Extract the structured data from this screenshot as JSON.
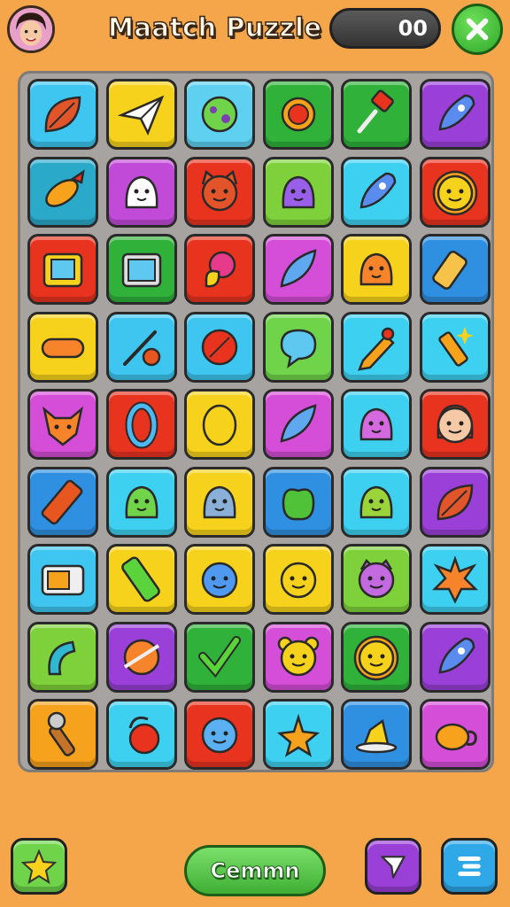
{
  "header": {
    "title": "Maatch Puzzle",
    "score": "00"
  },
  "board": {
    "rows": 9,
    "columns": 6,
    "tiles": [
      {
        "color": "#3ec6f0",
        "icon": "leaf-icon"
      },
      {
        "color": "#f7d21c",
        "icon": "paper-plane-icon"
      },
      {
        "color": "#5fd0ef",
        "icon": "green-planet-icon"
      },
      {
        "color": "#2fb13a",
        "icon": "gem-icon"
      },
      {
        "color": "#2fb13a",
        "icon": "pushpin-icon"
      },
      {
        "color": "#9a3fd8",
        "icon": "rocket-icon"
      },
      {
        "color": "#2aa9c9",
        "icon": "fish-icon"
      },
      {
        "color": "#c24ad8",
        "icon": "ghost-icon"
      },
      {
        "color": "#e8331f",
        "icon": "cat-face-icon"
      },
      {
        "color": "#7ed13a",
        "icon": "purple-blob-icon"
      },
      {
        "color": "#3ed0f0",
        "icon": "rocket-icon"
      },
      {
        "color": "#e8331f",
        "icon": "lion-face-icon"
      },
      {
        "color": "#e8331f",
        "icon": "tv-icon"
      },
      {
        "color": "#2fb13a",
        "icon": "tablet-icon"
      },
      {
        "color": "#e8331f",
        "icon": "fruit-icon"
      },
      {
        "color": "#d54ed8",
        "icon": "feather-icon"
      },
      {
        "color": "#f7d21c",
        "icon": "smile-blob-icon"
      },
      {
        "color": "#2f8fe0",
        "icon": "battery-icon"
      },
      {
        "color": "#f7d21c",
        "icon": "sausage-icon"
      },
      {
        "color": "#3ec6f0",
        "icon": "wand-icon"
      },
      {
        "color": "#3ec6f0",
        "icon": "red-leaf-icon"
      },
      {
        "color": "#6fd44a",
        "icon": "speech-bubble-icon"
      },
      {
        "color": "#3ed0f0",
        "icon": "pencil-icon"
      },
      {
        "color": "#3ed0f0",
        "icon": "sparkle-pencil-icon"
      },
      {
        "color": "#d54ed8",
        "icon": "fox-face-icon"
      },
      {
        "color": "#e8331f",
        "icon": "zero-icon"
      },
      {
        "color": "#f7d21c",
        "icon": "lemon-icon"
      },
      {
        "color": "#d54ed8",
        "icon": "feather-icon"
      },
      {
        "color": "#3ed0f0",
        "icon": "pink-blob-icon"
      },
      {
        "color": "#e8331f",
        "icon": "girl-face-icon"
      },
      {
        "color": "#2f8fe0",
        "icon": "crayon-icon"
      },
      {
        "color": "#3ed0f0",
        "icon": "green-blob-icon"
      },
      {
        "color": "#f7d21c",
        "icon": "wink-blob-icon"
      },
      {
        "color": "#2f8fe0",
        "icon": "apple-icon"
      },
      {
        "color": "#3ed0f0",
        "icon": "cactus-face-icon"
      },
      {
        "color": "#9a3fd8",
        "icon": "leaf-icon"
      },
      {
        "color": "#3ec6f0",
        "icon": "camera-icon"
      },
      {
        "color": "#f7d21c",
        "icon": "marker-icon"
      },
      {
        "color": "#f7d21c",
        "icon": "blue-blob-icon"
      },
      {
        "color": "#f7d21c",
        "icon": "smile-face-icon"
      },
      {
        "color": "#7ed13a",
        "icon": "purple-cat-icon"
      },
      {
        "color": "#3ed0f0",
        "icon": "star-burst-icon"
      },
      {
        "color": "#7ed13a",
        "icon": "wave-icon"
      },
      {
        "color": "#9a3fd8",
        "icon": "ball-icon"
      },
      {
        "color": "#2fb13a",
        "icon": "checkmark-icon"
      },
      {
        "color": "#d54ed8",
        "icon": "bear-face-icon"
      },
      {
        "color": "#2fb13a",
        "icon": "lion-face-icon"
      },
      {
        "color": "#9a3fd8",
        "icon": "rocket-icon"
      },
      {
        "color": "#f7a21c",
        "icon": "microphone-icon"
      },
      {
        "color": "#3ed0f0",
        "icon": "swirl-icon"
      },
      {
        "color": "#e8331f",
        "icon": "blue-face-icon"
      },
      {
        "color": "#3ed0f0",
        "icon": "starfish-icon"
      },
      {
        "color": "#2f8fe0",
        "icon": "cake-icon"
      },
      {
        "color": "#d54ed8",
        "icon": "teapot-icon"
      }
    ]
  },
  "bottom_bar": {
    "left_button_icon": "star-icon",
    "center_button_label": "Cemmn",
    "right_button_1_icon": "arrow-icon",
    "right_button_2_icon": "menu-icon"
  }
}
